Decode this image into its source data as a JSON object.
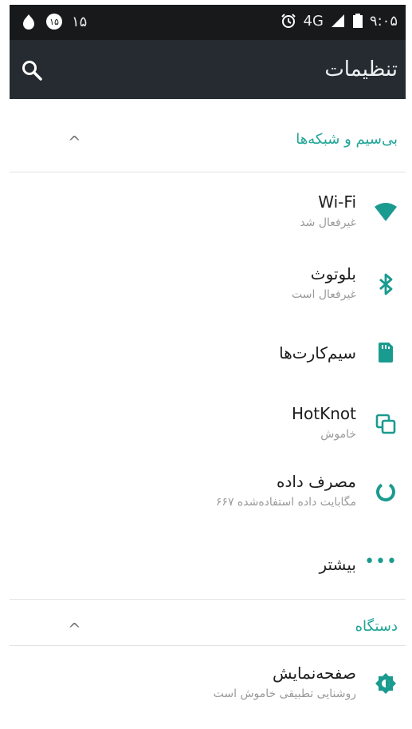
{
  "status_bar": {
    "left_text": "۱۵",
    "network": "4G",
    "time": "۹:۰۵"
  },
  "app_bar": {
    "title": "تنظیمات",
    "search_icon": "search-icon"
  },
  "sections": [
    {
      "label": "بی‌سیم و شبکه‌ها",
      "collapse_icon": "chevron-up-icon"
    },
    {
      "label": "دستگاه",
      "collapse_icon": "chevron-up-icon"
    }
  ],
  "wireless_items": [
    {
      "title": "Wi-Fi",
      "subtitle": "غیرفعال شد",
      "icon": "wifi-icon"
    },
    {
      "title": "بلوتوث",
      "subtitle": "غیرفعال است",
      "icon": "bluetooth-icon"
    },
    {
      "title": "سیم‌کارت‌ها",
      "subtitle": "",
      "icon": "sim-card-icon"
    },
    {
      "title": "HotKnot",
      "subtitle": "خاموش",
      "icon": "hotknot-icon"
    },
    {
      "title": "مصرف داده",
      "subtitle": "۶۶۷ مگابایت داده استفاده‌شده",
      "icon": "data-usage-icon"
    },
    {
      "title": "بیشتر",
      "subtitle": "",
      "icon": "more-dots-icon"
    }
  ],
  "device_items": [
    {
      "title": "صفحه‌نمایش",
      "subtitle": "روشنایی تطبیقی خاموش است",
      "icon": "brightness-icon"
    }
  ],
  "colors": {
    "accent": "#1a9b8f",
    "status_bar": "#17191b",
    "app_bar": "#252b31"
  }
}
